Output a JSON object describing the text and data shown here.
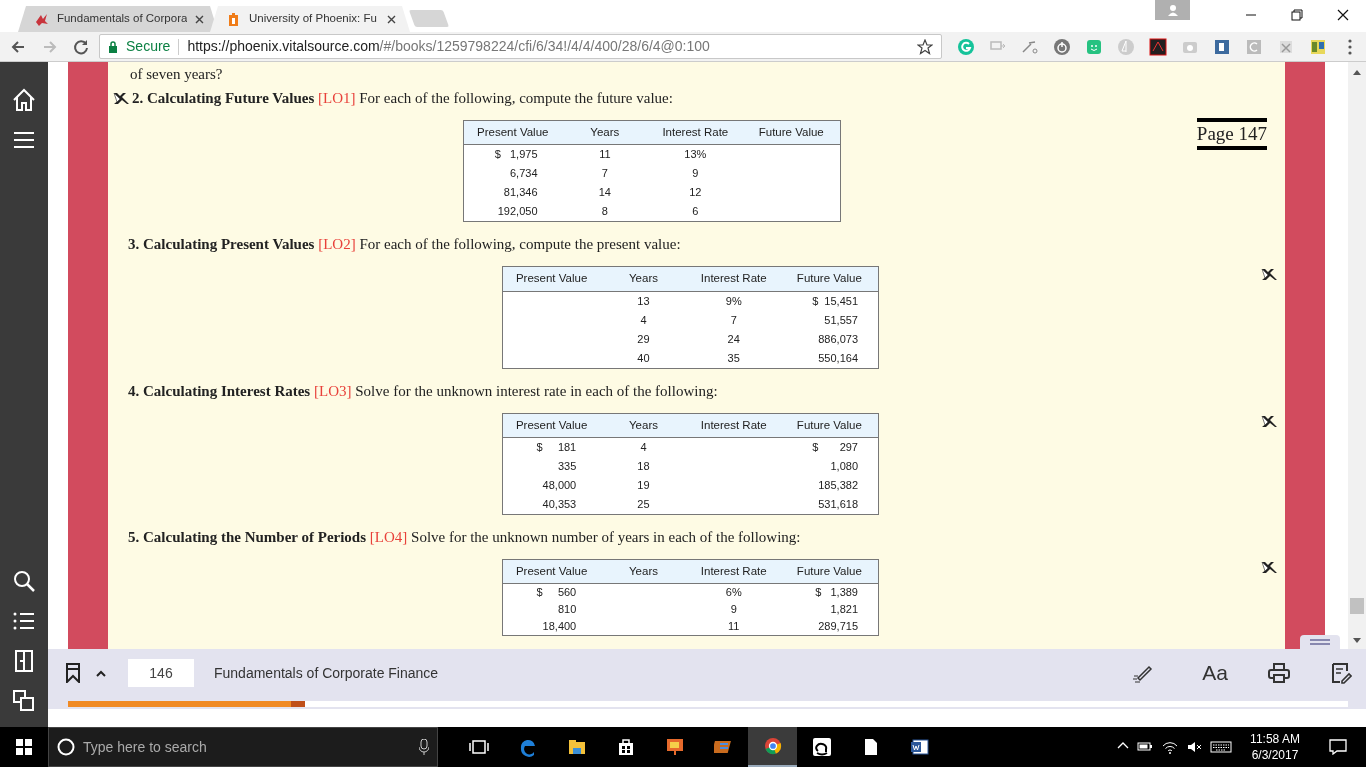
{
  "browser": {
    "tabs": [
      {
        "title": "Fundamentals of Corpora",
        "selected": false,
        "kind": "book"
      },
      {
        "title": "University of Phoenix: Fu",
        "selected": true,
        "kind": "phoenix"
      }
    ],
    "address": {
      "secure_label": "Secure",
      "host": "https://phoenix.vitalsource.com",
      "path": "/#/books/1259798224/cfi/6/34!/4/4/400/28/6/4@0:100"
    }
  },
  "reader": {
    "previous_text": "of seven years?",
    "problems": [
      {
        "number": "2.",
        "title": "Calculating Future Values",
        "objective": "[LO1]",
        "instruction": "For each of the following, compute the future value:",
        "page_marker": "Page 147",
        "table": {
          "columns": [
            "Present Value",
            "Years",
            "Interest Rate",
            "Future Value"
          ],
          "rows": [
            [
              "$   1,975",
              "11",
              "13%",
              ""
            ],
            [
              "6,734",
              "7",
              "9",
              ""
            ],
            [
              "81,346",
              "14",
              "12",
              ""
            ],
            [
              "192,050",
              "8",
              "6",
              ""
            ]
          ]
        }
      },
      {
        "number": "3.",
        "title": "Calculating Present Values",
        "objective": "[LO2]",
        "instruction": "For each of the following, compute the present value:",
        "table": {
          "columns": [
            "Present Value",
            "Years",
            "Interest Rate",
            "Future Value"
          ],
          "rows": [
            [
              "",
              "13",
              "9%",
              "$  15,451"
            ],
            [
              "",
              "4",
              "7",
              "51,557"
            ],
            [
              "",
              "29",
              "24",
              "886,073"
            ],
            [
              "",
              "40",
              "35",
              "550,164"
            ]
          ]
        }
      },
      {
        "number": "4.",
        "title": "Calculating Interest Rates",
        "objective": "[LO3]",
        "instruction": "Solve for the unknown interest rate in each of the following:",
        "table": {
          "columns": [
            "Present Value",
            "Years",
            "Interest Rate",
            "Future Value"
          ],
          "rows": [
            [
              "$     181",
              "4",
              "",
              "$       297"
            ],
            [
              "335",
              "18",
              "",
              "1,080"
            ],
            [
              "48,000",
              "19",
              "",
              "185,382"
            ],
            [
              "40,353",
              "25",
              "",
              "531,618"
            ]
          ]
        }
      },
      {
        "number": "5.",
        "title": "Calculating the Number of Periods",
        "objective": "[LO4]",
        "instruction": "Solve for the unknown number of years in each of the following:",
        "table": {
          "columns": [
            "Present Value",
            "Years",
            "Interest Rate",
            "Future Value"
          ],
          "rows": [
            [
              "$     560",
              "",
              "6%",
              "$   1,389"
            ],
            [
              "810",
              "",
              "9",
              "1,821"
            ],
            [
              "18,400",
              "",
              "11",
              "289,715"
            ]
          ]
        }
      }
    ]
  },
  "bottom_bar": {
    "page": "146",
    "book_title": "Fundamentals of Corporate Finance",
    "level": 0.185,
    "text_size_label": "Aa"
  },
  "taskbar": {
    "search_placeholder": "Type here to search",
    "time": "11:58 AM",
    "date": "6/3/2017"
  }
}
